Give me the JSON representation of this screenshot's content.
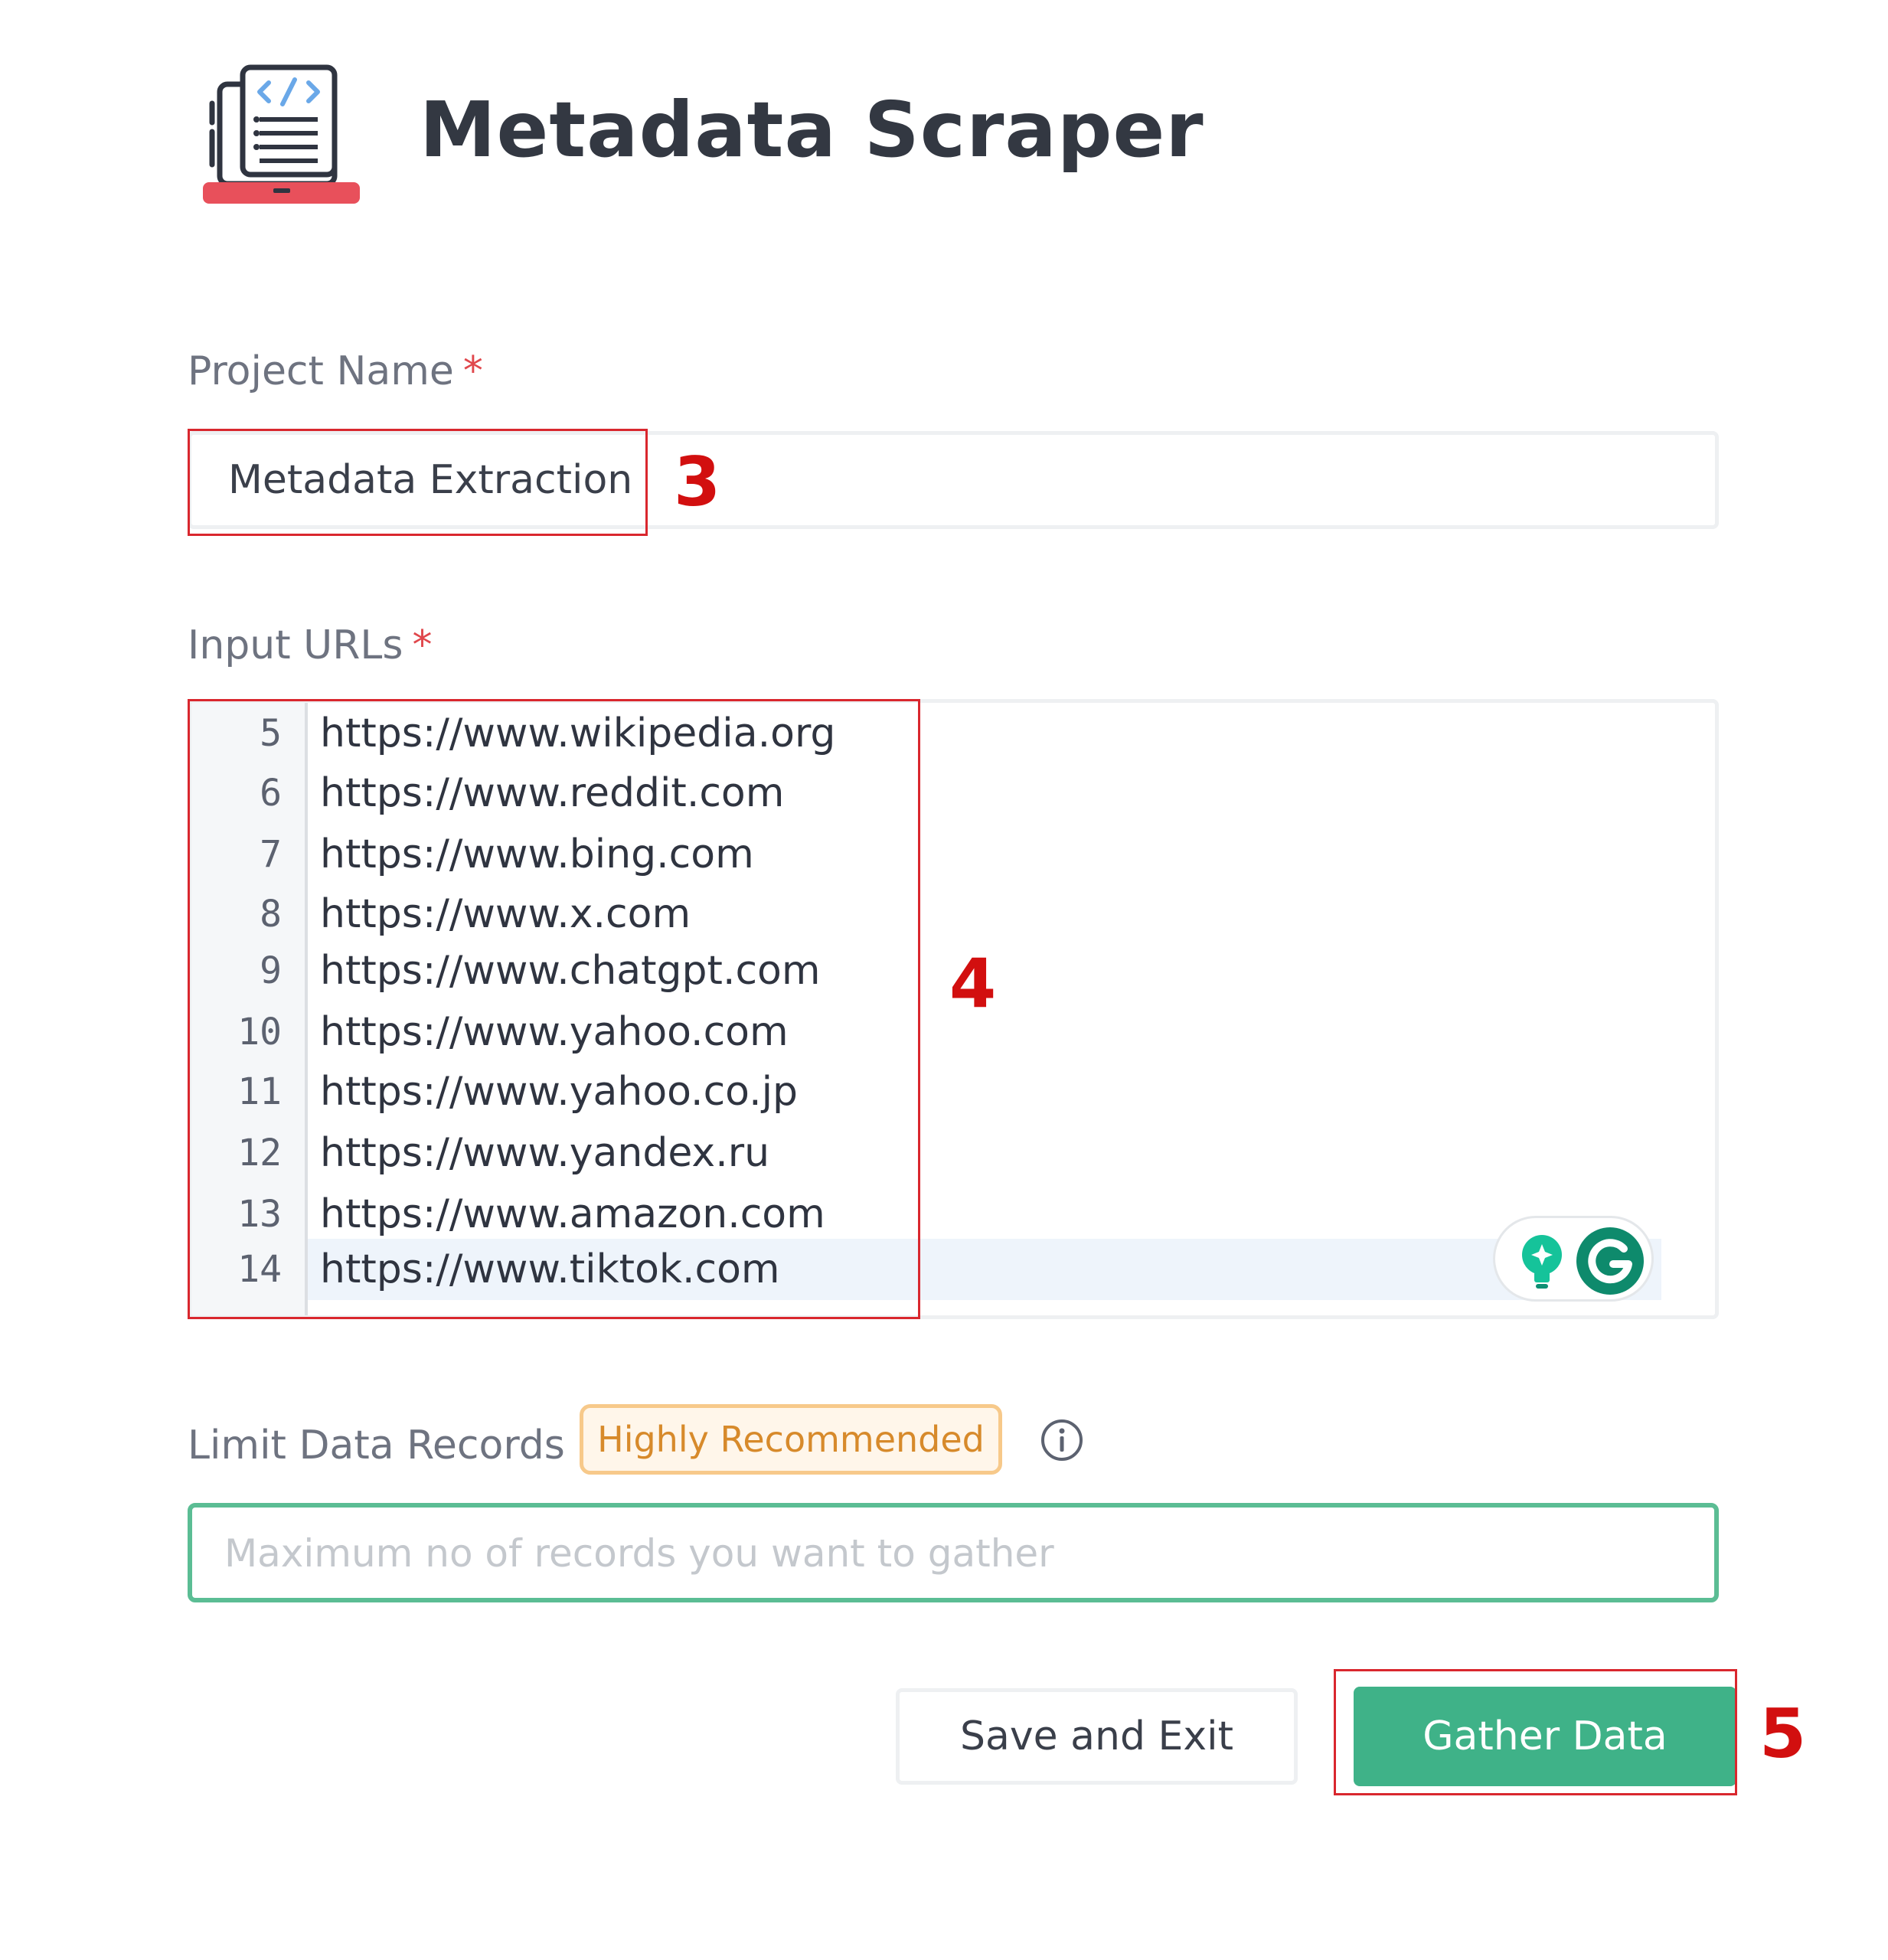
{
  "header": {
    "title": "Metadata Scraper",
    "logo_icon": "code-document-laptop-icon"
  },
  "project_name": {
    "label": "Project Name",
    "required_marker": "*",
    "value": "Metadata Extraction"
  },
  "input_urls": {
    "label": "Input URLs",
    "required_marker": "*",
    "lines": [
      {
        "number": "5",
        "text": "https://www.wikipedia.org"
      },
      {
        "number": "6",
        "text": "https://www.reddit.com"
      },
      {
        "number": "7",
        "text": "https://www.bing.com"
      },
      {
        "number": "8",
        "text": "https://www.x.com"
      },
      {
        "number": "9",
        "text": "https://www.chatgpt.com"
      },
      {
        "number": "10",
        "text": "https://www.yahoo.com"
      },
      {
        "number": "11",
        "text": "https://www.yahoo.co.jp"
      },
      {
        "number": "12",
        "text": "https://www.yandex.ru"
      },
      {
        "number": "13",
        "text": "https://www.amazon.com"
      },
      {
        "number": "14",
        "text": "https://www.tiktok.com"
      }
    ],
    "active_line": "14",
    "widget_icons": [
      "lightbulb-icon",
      "grammarly-icon"
    ]
  },
  "limit_records": {
    "label": "Limit Data Records",
    "badge": "Highly Recommended",
    "info_icon": "info-icon",
    "placeholder": "Maximum no of records you want to gather",
    "value": ""
  },
  "actions": {
    "save_label": "Save and Exit",
    "gather_label": "Gather Data"
  },
  "annotations": {
    "step_project_name": "3",
    "step_urls": "4",
    "step_gather": "5"
  },
  "colors": {
    "accent_green": "#3fb288",
    "focus_border": "#5bbd94",
    "required_red": "#e0474c",
    "badge_orange": "#d78a2b",
    "annotation_red": "#d20f0f",
    "logo_red": "#e8505b",
    "logo_blue": "#6aa8e8"
  }
}
